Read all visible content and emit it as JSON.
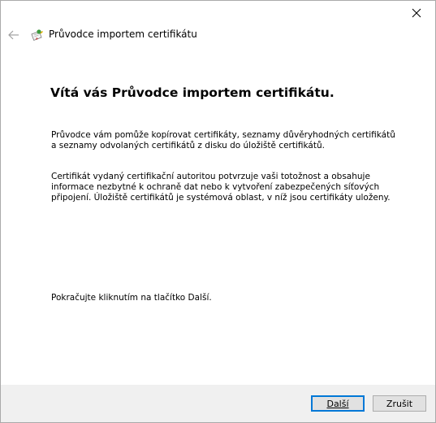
{
  "window": {
    "close_icon": "close-icon"
  },
  "header": {
    "back_icon": "back-arrow-icon",
    "wizard_icon": "certificate-icon",
    "title": "Průvodce importem certifikátu"
  },
  "content": {
    "heading": "Vítá vás Průvodce importem certifikátu.",
    "paragraph1": "Průvodce vám pomůže kopírovat certifikáty, seznamy důvěryhodných certifikátů a seznamy odvolaných certifikátů z disku do úložiště certifikátů.",
    "paragraph2": "Certifikát vydaný certifikační autoritou potvrzuje vaši totožnost a obsahuje informace nezbytné k ochraně dat nebo k vytvoření zabezpečených síťových připojení. Úložiště certifikátů je systémová oblast, v níž jsou certifikáty uloženy.",
    "paragraph3": "Pokračujte kliknutím na tlačítko Další."
  },
  "footer": {
    "next_label": "Další",
    "cancel_label": "Zrušit"
  },
  "colors": {
    "accent": "#0078d7",
    "footer_bg": "#f0f0f0",
    "button_bg": "#e1e1e1"
  }
}
